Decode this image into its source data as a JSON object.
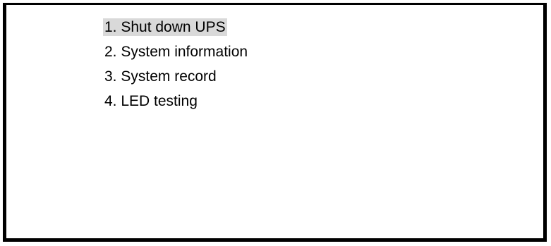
{
  "menu": {
    "selected_index": 0,
    "items": [
      {
        "label": "1. Shut down UPS"
      },
      {
        "label": "2. System information"
      },
      {
        "label": "3. System record"
      },
      {
        "label": "4. LED testing"
      }
    ]
  },
  "colors": {
    "highlight": "#d9d9d9",
    "border": "#000000",
    "text": "#000000",
    "background": "#ffffff"
  }
}
